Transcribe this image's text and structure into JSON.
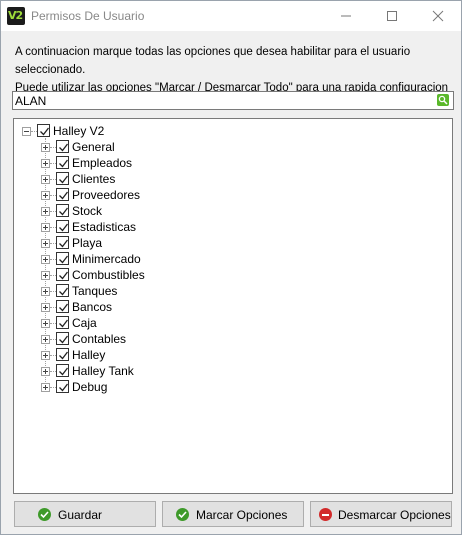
{
  "window": {
    "app_icon_text": "V2",
    "title": "Permisos De Usuario",
    "minimize_glyph": "minimize-icon",
    "maximize_glyph": "maximize-icon",
    "close_glyph": "close-icon"
  },
  "instructions": {
    "line1": "A continuacion marque todas las opciones que desea habilitar para el usuario seleccionado.",
    "line2": "Puede utilizar las opciones \"Marcar / Desmarcar Todo\" para una rapida configuracion"
  },
  "search": {
    "value": "ALAN",
    "icon": "search-icon"
  },
  "tree": {
    "root": {
      "label": "Halley V2",
      "checked": true,
      "expanded": true
    },
    "items": [
      {
        "label": "General",
        "checked": true
      },
      {
        "label": "Empleados",
        "checked": true
      },
      {
        "label": "Clientes",
        "checked": true
      },
      {
        "label": "Proveedores",
        "checked": true
      },
      {
        "label": "Stock",
        "checked": true
      },
      {
        "label": "Estadisticas",
        "checked": true
      },
      {
        "label": "Playa",
        "checked": true
      },
      {
        "label": "Minimercado",
        "checked": true
      },
      {
        "label": "Combustibles",
        "checked": true
      },
      {
        "label": "Tanques",
        "checked": true
      },
      {
        "label": "Bancos",
        "checked": true
      },
      {
        "label": "Caja",
        "checked": true
      },
      {
        "label": "Contables",
        "checked": true
      },
      {
        "label": "Halley",
        "checked": true
      },
      {
        "label": "Halley Tank",
        "checked": true
      },
      {
        "label": "Debug",
        "checked": true
      }
    ]
  },
  "buttons": {
    "save": {
      "label": "Guardar",
      "icon": "check-circle-icon"
    },
    "mark_all": {
      "label": "Marcar Opciones",
      "icon": "check-circle-icon"
    },
    "unmark_all": {
      "label": "Desmarcar Opciones",
      "icon": "minus-circle-icon"
    }
  },
  "colors": {
    "ok": "#3e9a2a",
    "cancel": "#d22a2a",
    "brand": "#9fdc3b"
  }
}
